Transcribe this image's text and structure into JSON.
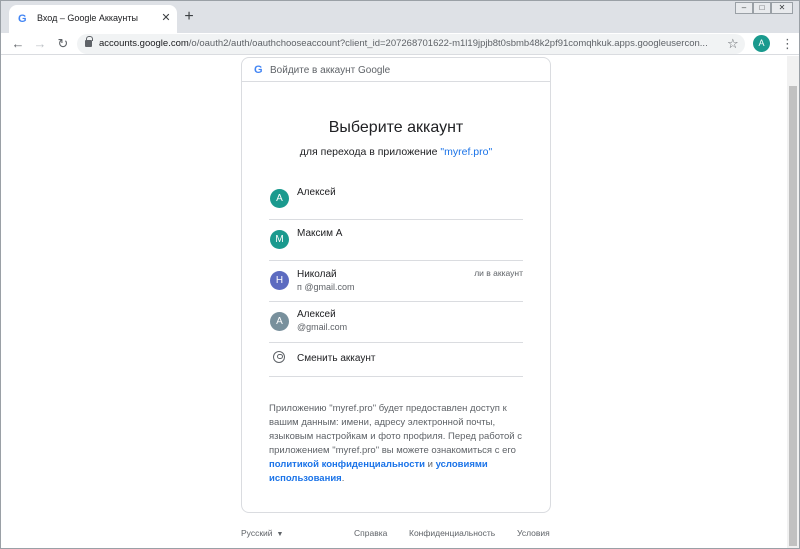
{
  "browser": {
    "tab_title": "Вход – Google Аккаунты",
    "tab_favicon": "G",
    "new_tab_symbol": "+",
    "close_symbol": "✕",
    "url_host": "accounts.google.com",
    "url_path": "/o/oauth2/auth/oauthchooseaccount?client_id=207268701622-m1l19jpjb8t0sbmb48k2pf91comqhkuk.apps.googleusercon...",
    "profile_initial": "A",
    "star_symbol": "☆",
    "menu_symbol": "⋮",
    "back_symbol": "←",
    "forward_symbol": "→",
    "reload_symbol": "↻"
  },
  "card": {
    "header_logo": "G",
    "header_text": "Войдите в аккаунт Google",
    "heading": "Выберите аккаунт",
    "sub_prefix": "для перехода в приложение ",
    "app_name": "\"myref.pro\"",
    "accounts": [
      {
        "initial": "А",
        "name": "Алексей",
        "email": "",
        "status": "",
        "color": "#1a9a8e"
      },
      {
        "initial": "М",
        "name": "Максим А",
        "email": "",
        "status": "",
        "color": "#1a9a8e"
      },
      {
        "initial": "Н",
        "name": "Николай",
        "email": "п                    @gmail.com",
        "status": "ли в аккаунт",
        "color": "#5c6bc0"
      },
      {
        "initial": "А",
        "name": "Алексей",
        "email": "              @gmail.com",
        "status": "",
        "color": "#78909c"
      }
    ],
    "switch_account": "Сменить аккаунт",
    "consent": {
      "text": "Приложению \"myref.pro\" будет предоставлен доступ к вашим данным: имени, адресу электронной почты, языковым настройкам и фото профиля. Перед работой с приложением \"myref.pro\" вы можете ознакомиться с его ",
      "privacy_link": "политикой конфиденциальности",
      "and": " и ",
      "terms_link": "условиями использования",
      "end": "."
    }
  },
  "footer": {
    "language": "Русский",
    "help": "Справка",
    "privacy": "Конфиденциальность",
    "terms": "Условия"
  }
}
